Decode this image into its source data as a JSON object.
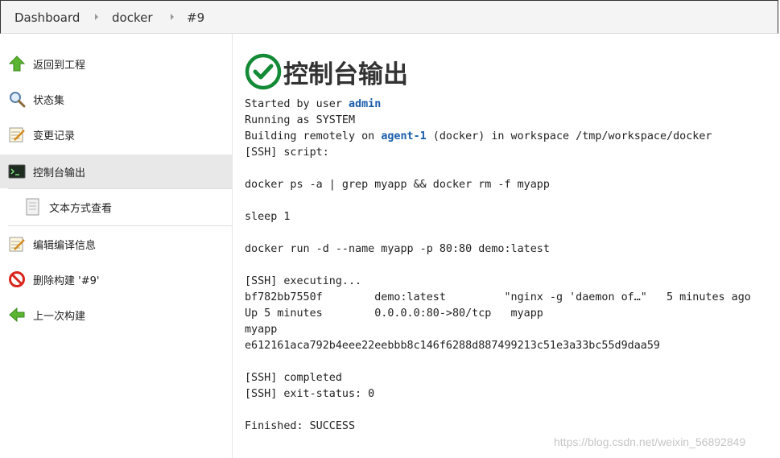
{
  "breadcrumbs": [
    "Dashboard",
    "docker",
    "#9"
  ],
  "sidebar": {
    "items": [
      {
        "label": "返回到工程",
        "icon": "up-arrow-icon"
      },
      {
        "label": "状态集",
        "icon": "magnifier-icon"
      },
      {
        "label": "变更记录",
        "icon": "notepad-icon"
      },
      {
        "label": "控制台输出",
        "icon": "terminal-icon",
        "active": true
      },
      {
        "label": "文本方式查看",
        "icon": "document-icon",
        "sub": true
      },
      {
        "label": "编辑编译信息",
        "icon": "notepad-icon"
      },
      {
        "label": "删除构建 '#9'",
        "icon": "no-entry-icon"
      },
      {
        "label": "上一次构建",
        "icon": "left-arrow-icon"
      }
    ]
  },
  "main": {
    "title": "控制台输出",
    "console": {
      "started_prefix": "Started by user ",
      "started_user": "admin",
      "line_running": "Running as SYSTEM",
      "building_prefix": "Building remotely on ",
      "building_agent": "agent-1",
      "building_suffix": " (docker) in workspace /tmp/workspace/docker",
      "line_script": "[SSH] script:",
      "line_cmd1": "docker ps -a | grep myapp && docker rm -f myapp",
      "line_cmd2": "sleep 1",
      "line_cmd3": "docker run -d --name myapp -p 80:80 demo:latest",
      "line_executing": "[SSH] executing...",
      "line_ps1": "bf782bb7550f        demo:latest         \"nginx -g 'daemon of…\"   5 minutes ago",
      "line_ps2": "Up 5 minutes        0.0.0.0:80->80/tcp   myapp",
      "line_myapp": "myapp",
      "line_hash": "e612161aca792b4eee22eebbb8c146f6288d887499213c51e3a33bc55d9daa59",
      "line_completed": "[SSH] completed",
      "line_exit": "[SSH] exit-status: 0",
      "line_finished": "Finished: SUCCESS"
    }
  },
  "watermark": "https://blog.csdn.net/weixin_56892849",
  "colors": {
    "link": "#1a5dab",
    "success": "#138a36",
    "active_bg": "#e8e8e8"
  }
}
